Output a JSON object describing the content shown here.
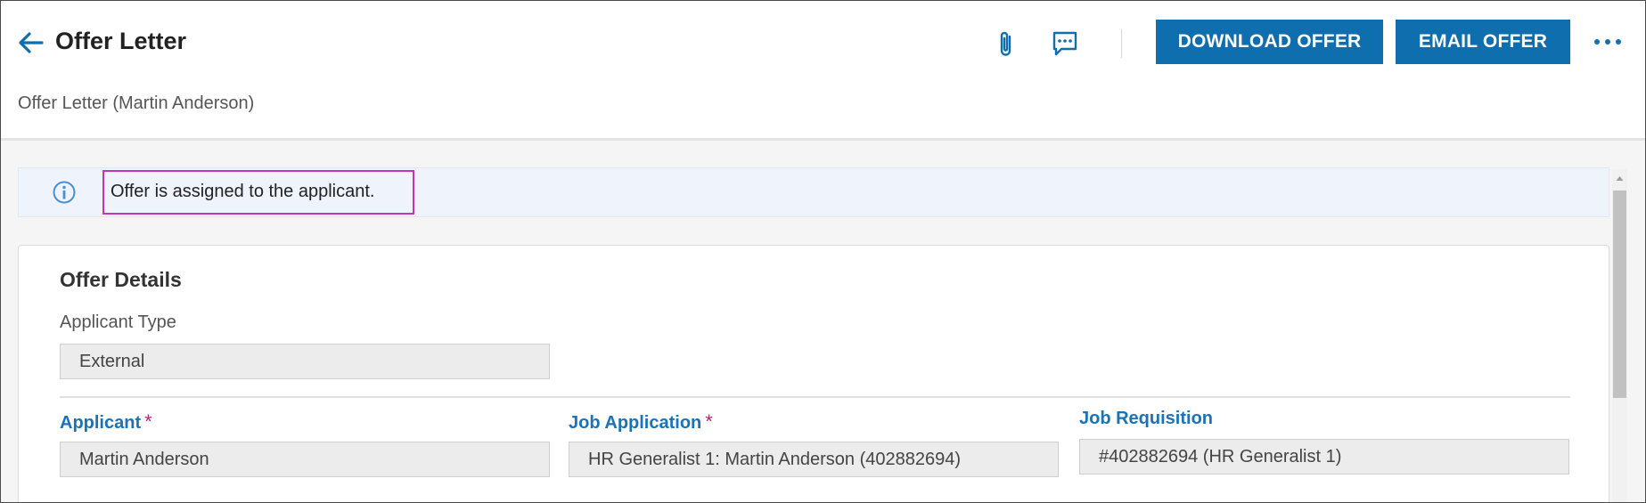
{
  "header": {
    "title": "Offer Letter",
    "subtitle": "Offer Letter (Martin Anderson)",
    "download_label": "DOWNLOAD OFFER",
    "email_label": "EMAIL OFFER",
    "icons": [
      "arrow-left-icon",
      "paperclip-icon",
      "comment-icon",
      "more-horizontal-icon"
    ]
  },
  "banner": {
    "message": "Offer is assigned to the applicant.",
    "icon": "info-icon"
  },
  "offer_details": {
    "section_title": "Offer Details",
    "applicant_type_label": "Applicant Type",
    "applicant_type_value": "External",
    "applicant_label": "Applicant",
    "applicant_value": "Martin Anderson",
    "job_application_label": "Job Application",
    "job_application_value": "HR Generalist 1: Martin Anderson (402882694)",
    "job_requisition_label": "Job Requisition",
    "job_requisition_value": "#402882694 (HR Generalist 1)",
    "required_marker": "*"
  },
  "colors": {
    "accent": "#0f6eae",
    "label_blue": "#1a73b8",
    "required": "#c2227a",
    "highlight": "#c635b9"
  }
}
